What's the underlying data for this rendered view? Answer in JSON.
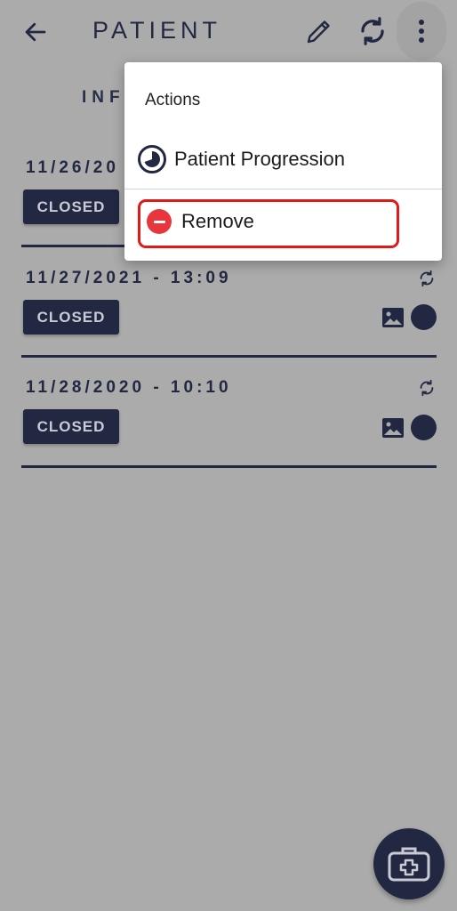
{
  "header": {
    "title": "PATIENT",
    "back_icon": "arrow-left-icon",
    "edit_icon": "pencil-icon",
    "sync_icon": "sync-icon",
    "more_icon": "more-vertical-icon"
  },
  "tab": {
    "label": "INF"
  },
  "records": [
    {
      "date": "11/26/20",
      "status": "CLOSED"
    },
    {
      "date": "11/27/2021 - 13:09",
      "status": "CLOSED"
    },
    {
      "date": "11/28/2020 - 10:10",
      "status": "CLOSED"
    }
  ],
  "menu": {
    "heading": "Actions",
    "items": [
      {
        "label": "Patient Progression",
        "icon": "progression-icon"
      },
      {
        "label": "Remove",
        "icon": "remove-icon"
      }
    ]
  },
  "fab": {
    "icon": "medical-kit-icon"
  },
  "colors": {
    "primary": "#222842",
    "scrim_background": "#ababab",
    "remove_red": "#e8363c",
    "highlight_red": "#e01919"
  }
}
